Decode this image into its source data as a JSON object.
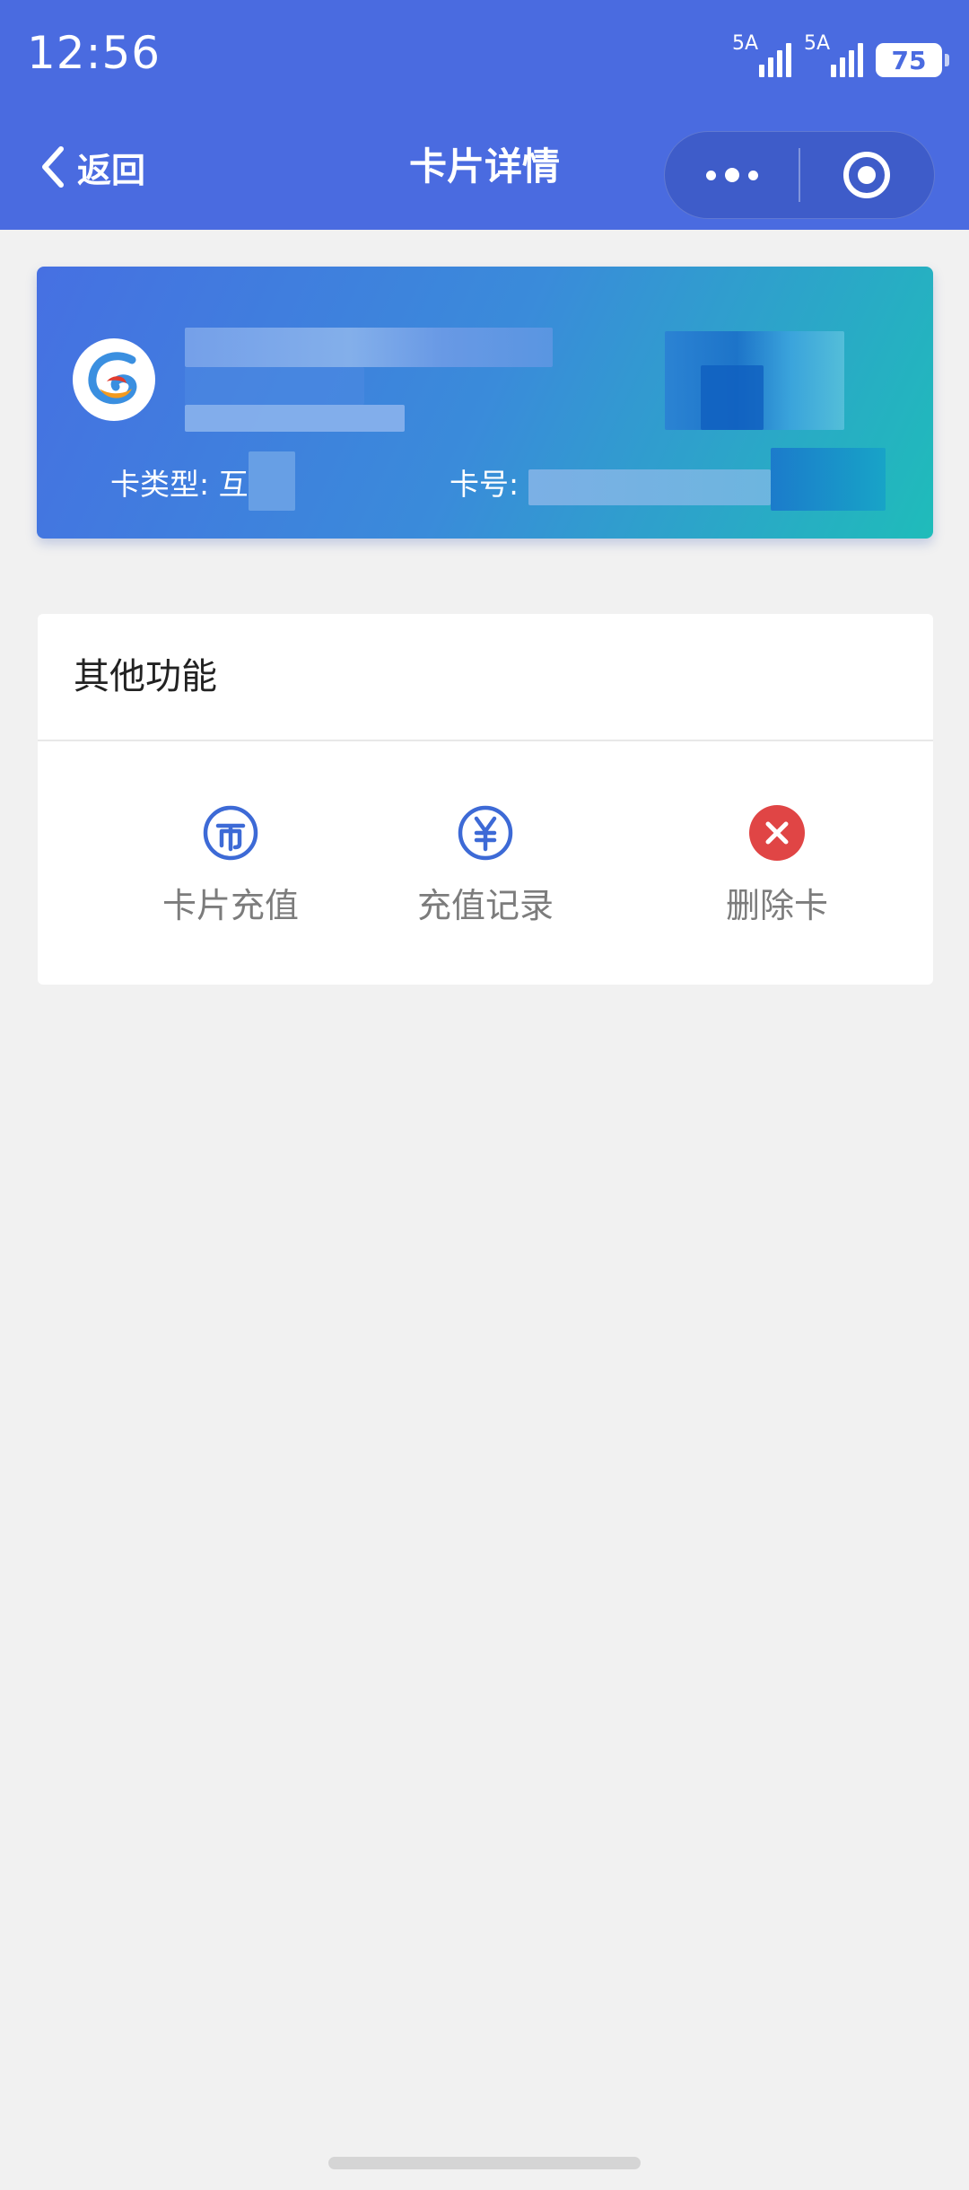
{
  "status_bar": {
    "time": "12:56",
    "signal_1_label": "5A",
    "signal_2_label": "5A",
    "battery": "75"
  },
  "nav": {
    "back_label": "返回",
    "title": "卡片详情",
    "more_icon": "more-dots-icon",
    "close_icon": "target-circle-icon"
  },
  "card": {
    "logo_icon": "card-issuer-logo",
    "type_label": "卡类型: 互",
    "number_label": "卡号:",
    "gradient_start": "#4670e2",
    "gradient_end": "#1fbcba"
  },
  "functions": {
    "section_title": "其他功能",
    "actions": [
      {
        "label": "卡片充值",
        "icon": "coin-recharge-icon",
        "color": "#3d6ad6"
      },
      {
        "label": "充值记录",
        "icon": "yuan-record-icon",
        "color": "#3d6ad6"
      },
      {
        "label": "删除卡",
        "icon": "delete-x-icon",
        "color": "#e04545"
      }
    ]
  },
  "colors": {
    "header_bg": "#4a6be0",
    "page_bg": "#f1f1f1"
  }
}
